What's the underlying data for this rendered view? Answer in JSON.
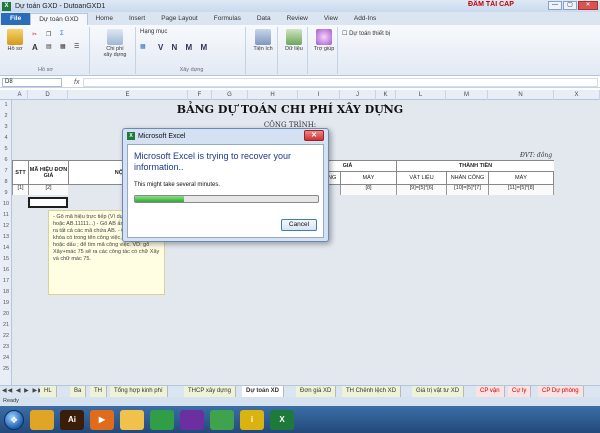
{
  "window": {
    "title": "Dự toán GXD - DutoanGXD1",
    "brand": "ĐÂM TÀI CAP",
    "app_icon": "excel-icon",
    "controls": [
      "—",
      "▢",
      "✕"
    ]
  },
  "ribbon": {
    "tabs": [
      {
        "label": "File",
        "active": false
      },
      {
        "label": "Dự toán GXD",
        "active": true
      },
      {
        "label": "Home",
        "active": false
      },
      {
        "label": "Insert",
        "active": false
      },
      {
        "label": "Page Layout",
        "active": false
      },
      {
        "label": "Formulas",
        "active": false
      },
      {
        "label": "Data",
        "active": false
      },
      {
        "label": "Review",
        "active": false
      },
      {
        "label": "View",
        "active": false
      },
      {
        "label": "Add-Ins",
        "active": false
      }
    ],
    "groups": {
      "hoso": {
        "label": "Hồ sơ",
        "big": "Hồ sơ"
      },
      "chiphi": {
        "label": "Chi phí xây dựng",
        "big": "Chi phí xây dựng"
      },
      "xaydung": {
        "label": "Xây dựng",
        "hangmuc": "Hạng mục",
        "letters": "V N M M"
      },
      "tienich": {
        "label": "Tiện ích",
        "big": "Tiện ích"
      },
      "dulieu": {
        "big": "Dữ liệu"
      },
      "trogiup": {
        "big": "Trợ giúp"
      },
      "thietbi": "Dự toán thiết bị"
    }
  },
  "formula_bar": {
    "namebox": "D8",
    "fx": "fx"
  },
  "columns": [
    "A",
    "D",
    "E",
    "F",
    "G",
    "H",
    "I",
    "J",
    "K",
    "L",
    "M",
    "N",
    "X"
  ],
  "rows": [
    "1",
    "2",
    "3",
    "4",
    "5",
    "6",
    "7",
    "8",
    "9",
    "10",
    "11",
    "12",
    "13",
    "14",
    "15",
    "16",
    "17",
    "18",
    "19",
    "20",
    "21",
    "22",
    "23",
    "24",
    "25"
  ],
  "sheet": {
    "title": "BẢNG DỰ TOÁN CHI PHÍ XÂY DỰNG",
    "subtitle": "CÔNG TRÌNH:",
    "unit": "ĐVT: đồng",
    "headers": {
      "stt": "STT",
      "ma_hieu": "MÃ HIỆU ĐƠN GIÁ",
      "noi_dung": "NỘI DUNG",
      "gia": "GIÁ",
      "thanh_tien": "THÀNH TIỀN",
      "nhan_cong": "NHÂN CÔNG",
      "may": "MÁY",
      "vat_lieu": "VẬT LIỆU",
      "nhan_cong2": "NHÂN CÔNG",
      "may2": "MÁY"
    },
    "formula_row": [
      "[1]",
      "[2]",
      "[8]",
      "[9]=[5]*[6]",
      "[10]=[5]*[7]",
      "[11]=[5]*[8]"
    ],
    "tooltip": "- Gõ mã hiệu trực tiếp (Ví dụ: AB.11111 hoặc AB.11111...) - Gõ AB ấn Enter sẽ gọi ra tất cả các mã chứa AB. - Chọn gõ từ khóa có trong tên công việc, kết hợp dấu + hoặc dấu ; để tìm mã công việc. VD: gõ Xây+mác 75 sẽ ra các công tác có chữ Xây và chữ mác 75."
  },
  "dialog": {
    "title": "Microsoft Excel",
    "heading": "Microsoft Excel is trying to recover your information..",
    "note": "This might take several minutes.",
    "progress": 0.27,
    "cancel": "Cancel",
    "close": "✕"
  },
  "sheet_tabs": [
    {
      "label": "HL",
      "style": "normal"
    },
    {
      "label": "Ba",
      "style": "normal"
    },
    {
      "label": "TH",
      "style": "normal"
    },
    {
      "label": "Tổng hợp kinh phí",
      "style": "normal"
    },
    {
      "label": "THCP xây dựng",
      "style": "normal"
    },
    {
      "label": "Dự toán XD",
      "style": "active"
    },
    {
      "label": "Đơn giá XD",
      "style": "normal"
    },
    {
      "label": "TH Chênh lệch XD",
      "style": "normal"
    },
    {
      "label": "Giá trị vật tư XD",
      "style": "normal"
    },
    {
      "label": "CP vận",
      "style": "red"
    },
    {
      "label": "Cự ly",
      "style": "red"
    },
    {
      "label": "CP Dự phòng",
      "style": "red"
    }
  ],
  "status": "Ready",
  "taskbar": {
    "start": "start-orb",
    "apps": [
      {
        "name": "explorer",
        "label": "",
        "color": "#e0a526"
      },
      {
        "name": "illustrator",
        "label": "Ai",
        "color": "#3b1d0a"
      },
      {
        "name": "media-player",
        "label": "▶",
        "color": "#e06b1a"
      },
      {
        "name": "folder",
        "label": "",
        "color": "#f0c24b"
      },
      {
        "name": "chrome",
        "label": "",
        "color": "#2f9e46"
      },
      {
        "name": "visual-studio",
        "label": "",
        "color": "#6b2fa0"
      },
      {
        "name": "globe",
        "label": "",
        "color": "#3fa34d"
      },
      {
        "name": "app-i",
        "label": "i",
        "color": "#d9b410"
      },
      {
        "name": "excel",
        "label": "X",
        "color": "#1d7a3a"
      }
    ]
  }
}
